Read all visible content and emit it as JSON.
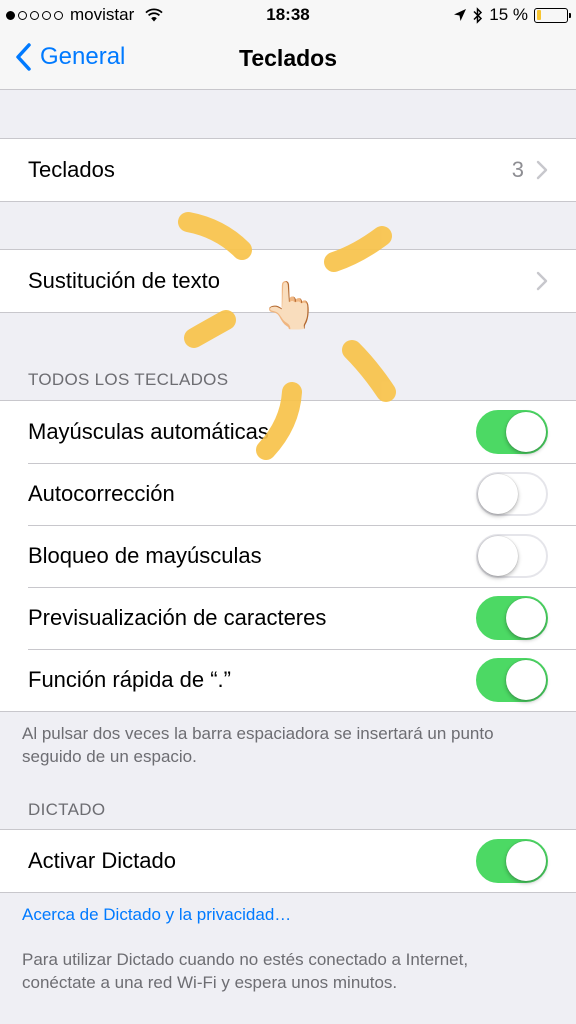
{
  "status_bar": {
    "carrier": "movistar",
    "time": "18:38",
    "battery_text": "15 %",
    "battery_level": 0.15,
    "battery_color": "#f7c531"
  },
  "nav": {
    "back_label": "General",
    "title": "Teclados"
  },
  "group_keyboards": {
    "label": "Teclados",
    "value": "3"
  },
  "group_text_replacement": {
    "label": "Sustitución de texto"
  },
  "all_keyboards": {
    "header": "TODOS LOS TECLADOS",
    "rows": [
      {
        "label": "Mayúsculas automáticas",
        "on": true
      },
      {
        "label": "Autocorrección",
        "on": false
      },
      {
        "label": "Bloqueo de mayúsculas",
        "on": false
      },
      {
        "label": "Previsualización de caracteres",
        "on": true
      },
      {
        "label": "Función rápida de “.”",
        "on": true
      }
    ],
    "footer": "Al pulsar dos veces la barra espaciadora se insertará un punto seguido de un espacio."
  },
  "dictation": {
    "header": "DICTADO",
    "row_label": "Activar Dictado",
    "row_on": true,
    "privacy_link": "Acerca de Dictado y la privacidad…",
    "footer": "Para utilizar Dictado cuando no estés conectado a Internet, conéctate a una red Wi-Fi y espera unos minutos."
  },
  "colors": {
    "accent": "#007aff",
    "toggle_on": "#4cd964",
    "tap_highlight": "#f8c34a"
  },
  "icons": [
    "wifi-icon",
    "location-arrow-icon",
    "bluetooth-icon",
    "battery-icon",
    "back-chevron-icon",
    "chevron-right-icon",
    "pointing-hand-icon"
  ]
}
